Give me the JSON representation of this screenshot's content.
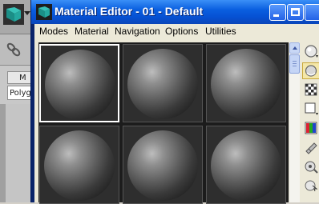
{
  "background_app": {
    "command_tab_label": "M",
    "command_field_value": "Polyg"
  },
  "material_editor": {
    "title": "Material Editor - 01 - Default",
    "menu": [
      "Modes",
      "Material",
      "Navigation",
      "Options",
      "Utilities"
    ],
    "sample_slots": [
      {
        "material": "sphere",
        "active": true
      },
      {
        "material": "sphere",
        "active": false
      },
      {
        "material": "sphere",
        "active": false
      },
      {
        "material": "sphere",
        "active": false
      },
      {
        "material": "sphere",
        "active": false
      },
      {
        "material": "sphere",
        "active": false
      }
    ],
    "side_tools": [
      {
        "icon": "sphere-sample-icon",
        "pressed": false
      },
      {
        "icon": "backlight-icon",
        "pressed": true
      },
      {
        "icon": "checker-background-icon",
        "pressed": false
      },
      {
        "icon": "sample-uv-tiling-icon",
        "pressed": false
      },
      {
        "icon": "video-color-check-icon",
        "pressed": false
      },
      {
        "icon": "make-preview-icon",
        "pressed": false
      },
      {
        "icon": "options-icon",
        "pressed": false
      },
      {
        "icon": "select-by-material-icon",
        "pressed": false
      }
    ]
  },
  "colors": {
    "title_bar": "#0651d3",
    "menu_bg": "#ece9d8",
    "slot_bg": "#2e2e2e",
    "active_slot_border": "#ffffff"
  }
}
